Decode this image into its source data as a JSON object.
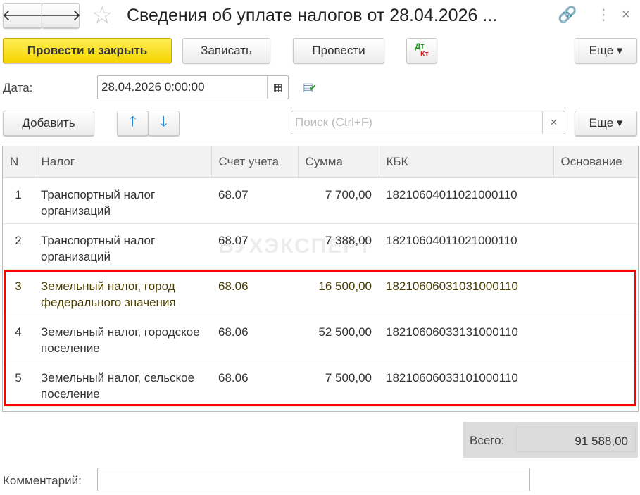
{
  "header": {
    "title": "Сведения об уплате налогов от 28.04.2026 ...",
    "close": "×"
  },
  "toolbar": {
    "post_close": "Провести и закрыть",
    "save": "Записать",
    "post": "Провести",
    "dt": "Дт",
    "kt": "Кт",
    "more": "Еще ▾"
  },
  "date": {
    "label": "Дата:",
    "value": "28.04.2026  0:00:00"
  },
  "table_toolbar": {
    "add": "Добавить",
    "search_placeholder": "Поиск (Ctrl+F)",
    "clear": "×",
    "more": "Еще ▾"
  },
  "table": {
    "headers": [
      "N",
      "Налог",
      "Счет учета",
      "Сумма",
      "КБК",
      "Основание"
    ],
    "rows": [
      {
        "n": "1",
        "tax": "Транспортный налог организаций",
        "account": "68.07",
        "sum": "7 700,00",
        "kbk": "18210604011021000110",
        "basis": ""
      },
      {
        "n": "2",
        "tax": "Транспортный налог организаций",
        "account": "68.07",
        "sum": "7 388,00",
        "kbk": "18210604011021000110",
        "basis": ""
      },
      {
        "n": "3",
        "tax": "Земельный налог, город федерального значения",
        "account": "68.06",
        "sum": "16 500,00",
        "kbk": "18210606031031000110",
        "basis": ""
      },
      {
        "n": "4",
        "tax": "Земельный налог, городское поселение",
        "account": "68.06",
        "sum": "52 500,00",
        "kbk": "18210606033131000110",
        "basis": ""
      },
      {
        "n": "5",
        "tax": "Земельный налог, сельское поселение",
        "account": "68.06",
        "sum": "7 500,00",
        "kbk": "18210606033101000110",
        "basis": ""
      }
    ]
  },
  "watermark": "БУХЭКСПЕРТ",
  "total": {
    "label": "Всего:",
    "value": "91 588,00"
  },
  "comment": {
    "label": "Комментарий:",
    "value": ""
  }
}
